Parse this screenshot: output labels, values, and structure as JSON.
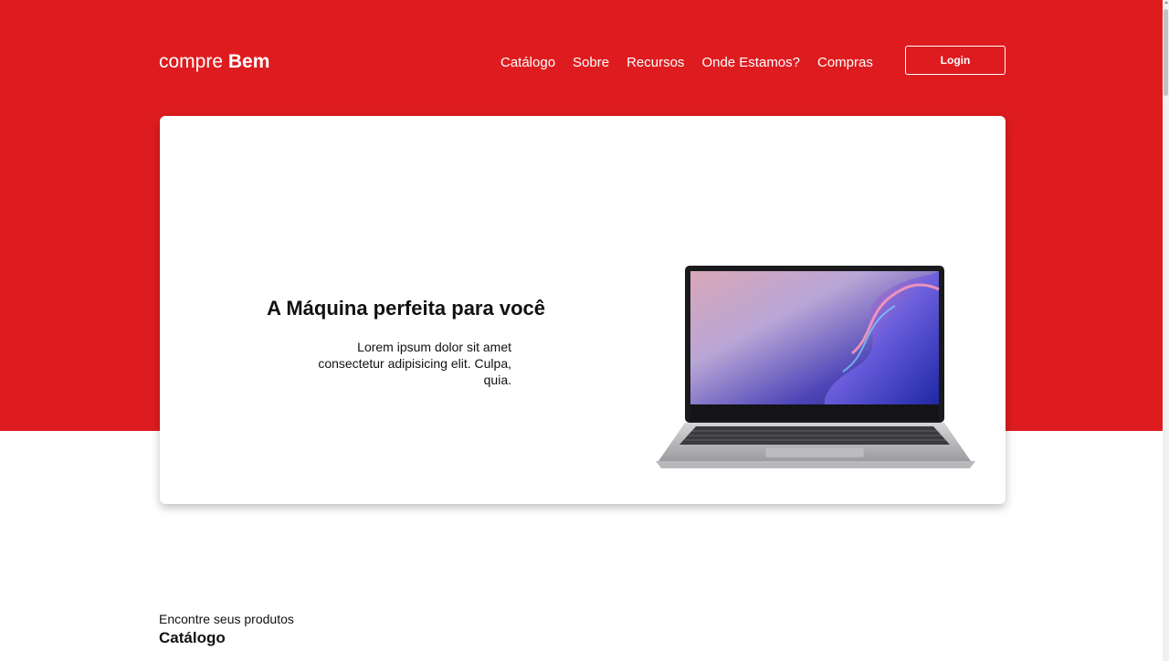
{
  "brand": {
    "light": "compre",
    "bold": "Bem"
  },
  "nav": {
    "items": [
      "Catálogo",
      "Sobre",
      "Recursos",
      "Onde Estamos?",
      "Compras"
    ]
  },
  "login": {
    "label": "Login"
  },
  "hero": {
    "title": "A Máquina perfeita para você",
    "text": "Lorem ipsum dolor sit amet consectetur adipisicing elit. Culpa, quia.",
    "image": "laptop-image"
  },
  "catalog": {
    "kicker": "Encontre seus produtos",
    "title": "Catálogo"
  },
  "colors": {
    "brand_red": "#de1c1f",
    "white": "#ffffff",
    "text": "#111111"
  }
}
